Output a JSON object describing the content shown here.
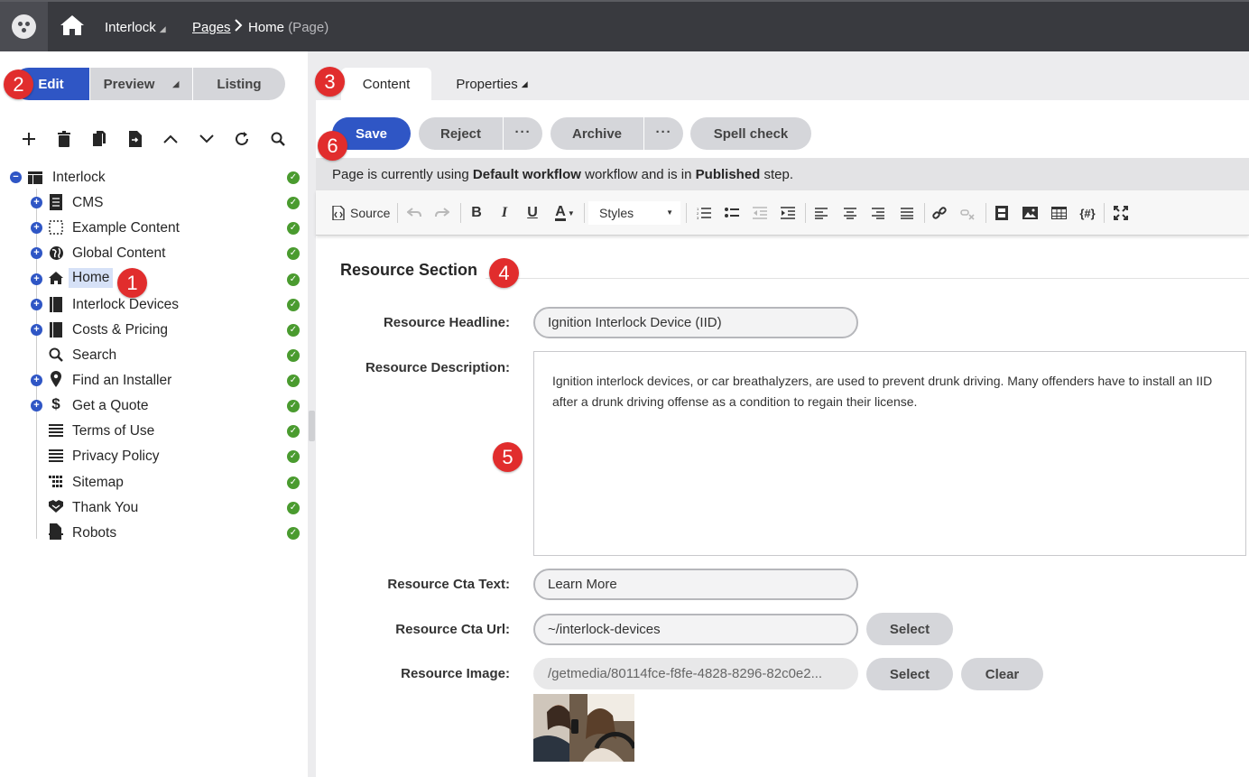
{
  "topbar": {
    "site": "Interlock",
    "breadcrumb_pages": "Pages",
    "breadcrumb_current": "Home",
    "breadcrumb_type": "(Page)"
  },
  "modes": [
    {
      "label": "Edit",
      "active": true
    },
    {
      "label": "Preview",
      "active": false
    },
    {
      "label": "Listing",
      "active": false
    }
  ],
  "tree_tools": [
    "plus-icon",
    "trash-icon",
    "copy-icon",
    "move-icon",
    "up-icon",
    "down-icon",
    "refresh-icon",
    "search-icon"
  ],
  "tree": [
    {
      "label": "Interlock",
      "icon": "table-icon",
      "status": "published"
    },
    {
      "label": "CMS",
      "icon": "document-icon",
      "status": "published"
    },
    {
      "label": "Example Content",
      "icon": "dashed-box-icon",
      "status": "published"
    },
    {
      "label": "Global Content",
      "icon": "globe-icon",
      "status": "published"
    },
    {
      "label": "Home",
      "icon": "home-icon",
      "status": "published",
      "selected": true
    },
    {
      "label": "Interlock Devices",
      "icon": "book-icon",
      "status": "published"
    },
    {
      "label": "Costs & Pricing",
      "icon": "book-icon",
      "status": "published"
    },
    {
      "label": "Search",
      "icon": "search-icon",
      "status": "published"
    },
    {
      "label": "Find an Installer",
      "icon": "map-pin-icon",
      "status": "published"
    },
    {
      "label": "Get a Quote",
      "icon": "dollar-icon",
      "status": "published"
    },
    {
      "label": "Terms of Use",
      "icon": "lines-icon",
      "status": "published"
    },
    {
      "label": "Privacy Policy",
      "icon": "lines-icon",
      "status": "published"
    },
    {
      "label": "Sitemap",
      "icon": "grid-icon",
      "status": "published"
    },
    {
      "label": "Thank You",
      "icon": "handshake-icon",
      "status": "published"
    },
    {
      "label": "Robots",
      "icon": "file-icon",
      "status": "published"
    }
  ],
  "tabs": [
    {
      "label": "Content",
      "active": true
    },
    {
      "label": "Properties",
      "active": false
    }
  ],
  "actions": {
    "save": "Save",
    "reject": "Reject",
    "archive": "Archive",
    "spell_check": "Spell check",
    "more": "···"
  },
  "workflow": {
    "prefix": "Page is currently using ",
    "workflow_name": "Default workflow",
    "middle": " workflow and is in ",
    "step": "Published",
    "suffix": " step."
  },
  "editor_toolbar": {
    "source": "Source",
    "styles": "Styles"
  },
  "section": {
    "title": "Resource Section"
  },
  "fields": {
    "headline_label": "Resource Headline:",
    "headline_value": "Ignition Interlock Device (IID)",
    "description_label": "Resource Description:",
    "description_value": "Ignition interlock devices, or car breathalyzers, are used to prevent drunk driving. Many offenders have to install an IID after a drunk driving offense as a condition to regain their license.",
    "cta_text_label": "Resource Cta Text:",
    "cta_text_value": "Learn More",
    "cta_url_label": "Resource Cta Url:",
    "cta_url_value": "~/interlock-devices",
    "image_label": "Resource Image:",
    "image_value": "/getmedia/80114fce-f8fe-4828-8296-82c0e2...",
    "select": "Select",
    "clear": "Clear"
  },
  "badges": [
    "1",
    "2",
    "3",
    "4",
    "5",
    "6"
  ],
  "colors": {
    "primary": "#2f56c5",
    "topbar": "#393a3f",
    "badge": "#e12d2d",
    "published": "#4a9b2f"
  }
}
